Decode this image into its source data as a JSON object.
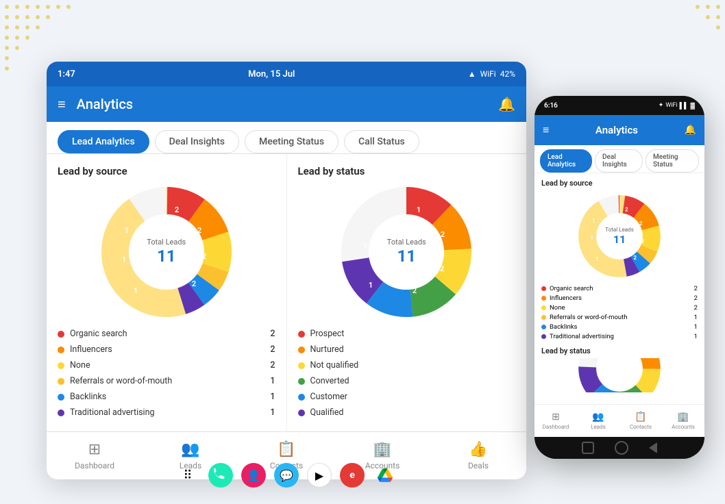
{
  "decoration": {
    "dots_color": "#e0c84a"
  },
  "tablet": {
    "status_bar": {
      "time": "1:47",
      "date": "Mon, 15 Jul",
      "battery": "42%"
    },
    "header": {
      "title": "Analytics",
      "menu_label": "menu",
      "bell_label": "notifications"
    },
    "tabs": [
      {
        "label": "Lead Analytics",
        "active": true
      },
      {
        "label": "Deal Insights",
        "active": false
      },
      {
        "label": "Meeting Status",
        "active": false
      },
      {
        "label": "Call Status",
        "active": false
      }
    ],
    "lead_by_source": {
      "title": "Lead by source",
      "total_label": "Total Leads",
      "total_value": "11",
      "legend": [
        {
          "label": "Organic search",
          "value": 2,
          "color": "#e53935"
        },
        {
          "label": "Influencers",
          "value": 2,
          "color": "#fb8c00"
        },
        {
          "label": "None",
          "value": 2,
          "color": "#fdd835"
        },
        {
          "label": "Referrals or word-of-mouth",
          "value": 1,
          "color": "#fbc02d"
        },
        {
          "label": "Backlinks",
          "value": 1,
          "color": "#1e88e5"
        },
        {
          "label": "Traditional advertising",
          "value": 1,
          "color": "#5e35b1"
        }
      ]
    },
    "lead_by_status": {
      "title": "Lead by status",
      "legend": [
        {
          "label": "Prospect",
          "value": null,
          "color": "#e53935"
        },
        {
          "label": "Nurtured",
          "value": null,
          "color": "#fb8c00"
        },
        {
          "label": "Not qualified",
          "value": null,
          "color": "#fdd835"
        },
        {
          "label": "Converted",
          "value": null,
          "color": "#43a047"
        },
        {
          "label": "Customer",
          "value": null,
          "color": "#1e88e5"
        },
        {
          "label": "Qualified",
          "value": null,
          "color": "#5e35b1"
        }
      ]
    },
    "bottom_nav": [
      {
        "label": "Dashboard",
        "icon": "⊞",
        "active": false
      },
      {
        "label": "Leads",
        "icon": "👥",
        "active": false
      },
      {
        "label": "Contacts",
        "icon": "📋",
        "active": false
      },
      {
        "label": "Accounts",
        "icon": "🏢",
        "active": false
      },
      {
        "label": "Deals",
        "icon": "👍",
        "active": false
      }
    ]
  },
  "phone": {
    "status_bar": {
      "time": "6:16",
      "battery": "100"
    },
    "header": {
      "title": "Analytics"
    },
    "tabs": [
      {
        "label": "Lead Analytics",
        "active": true
      },
      {
        "label": "Deal Insights",
        "active": false
      },
      {
        "label": "Meeting Status",
        "active": false
      }
    ],
    "lead_by_source": {
      "title": "Lead by source",
      "total_label": "Total Leads",
      "total_value": "11",
      "legend": [
        {
          "label": "Organic search",
          "value": 2,
          "color": "#e53935"
        },
        {
          "label": "Influencers",
          "value": 2,
          "color": "#fb8c00"
        },
        {
          "label": "None",
          "value": 2,
          "color": "#fdd835"
        },
        {
          "label": "Referrals or word-of-mouth",
          "value": 1,
          "color": "#fbc02d"
        },
        {
          "label": "Backlinks",
          "value": 1,
          "color": "#1e88e5"
        },
        {
          "label": "Traditional advertising",
          "value": 1,
          "color": "#5e35b1"
        }
      ]
    },
    "lead_by_status": {
      "title": "Lead by status"
    },
    "bottom_nav": [
      {
        "label": "Dashboard",
        "active": false
      },
      {
        "label": "Leads",
        "active": false
      },
      {
        "label": "Contacts",
        "active": false
      },
      {
        "label": "Accounts",
        "active": false
      }
    ]
  }
}
